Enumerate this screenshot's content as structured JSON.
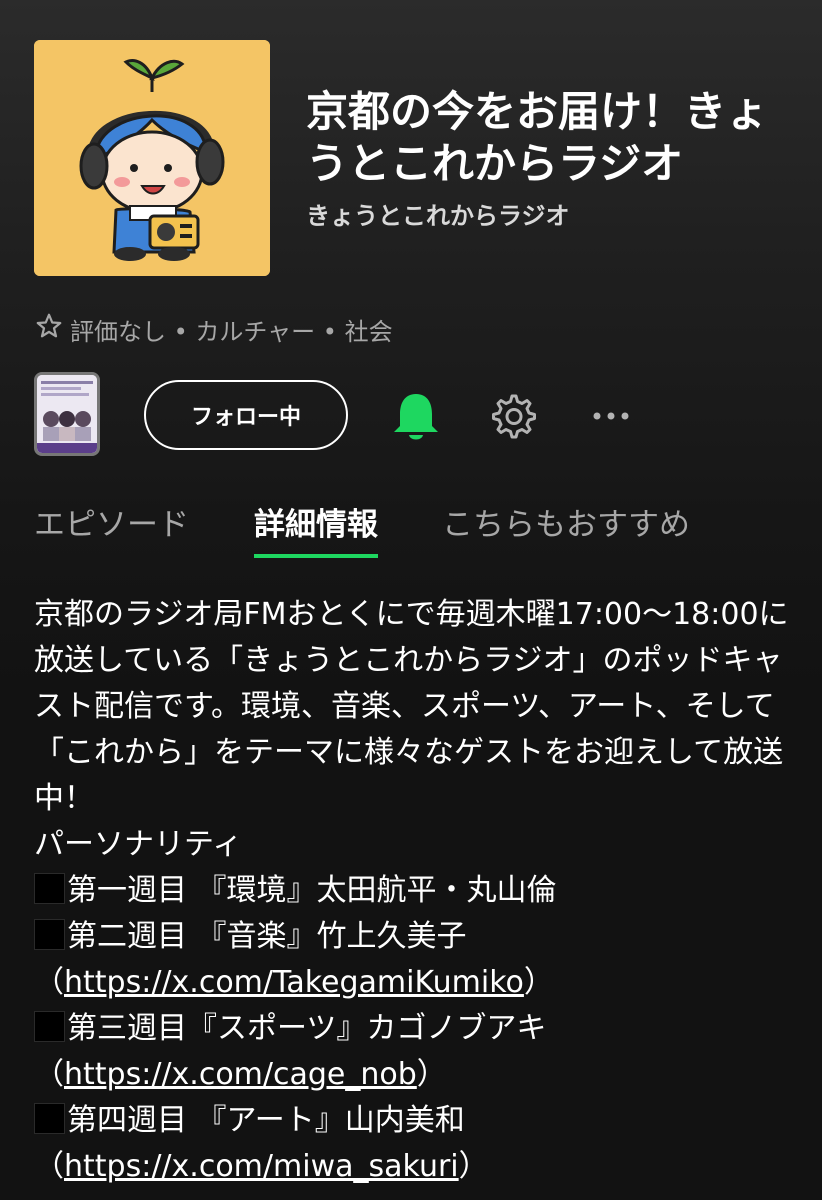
{
  "podcast": {
    "title": "京都の今をお届け！きょうとこれからラジオ",
    "publisher": "きょうとこれからラジオ",
    "meta": "評価なし • カルチャー • 社会"
  },
  "actions": {
    "follow_label": "フォロー中",
    "more_label": "···"
  },
  "tabs": [
    {
      "label": "エピソード",
      "active": false
    },
    {
      "label": "詳細情報",
      "active": true
    },
    {
      "label": "こちらもおすすめ",
      "active": false
    }
  ],
  "description": {
    "intro": "京都のラジオ局FMおとくにで毎週木曜17:00〜18:00に放送している「きょうとこれからラジオ」のポッドキャスト配信です。環境、音楽、スポーツ、アート、そして「これから」をテーマに様々なゲストをお迎えして放送中！",
    "personality_heading": "パーソナリティ",
    "weeks": [
      {
        "text": "第一週目 『環境』太田航平・丸山倫",
        "link": "",
        "suffix": ""
      },
      {
        "text": "第二週目 『音楽』竹上久美子（",
        "link": "https://x.com/TakegamiKumiko",
        "suffix": "）"
      },
      {
        "text": "第三週目『スポーツ』カゴノブアキ（",
        "link": "https://x.com/cage_nob",
        "suffix": "）"
      },
      {
        "text": "第四週目 『アート』山内美和（",
        "link": "https://x.com/miwa_sakuri",
        "suffix": "）"
      }
    ]
  },
  "colors": {
    "accent": "#1ed760",
    "background": "#121212",
    "cover_bg": "#f4c565"
  },
  "icons": {
    "star": "star-outline-icon",
    "bell": "bell-icon",
    "gear": "gear-icon",
    "more": "more-dots-icon"
  }
}
